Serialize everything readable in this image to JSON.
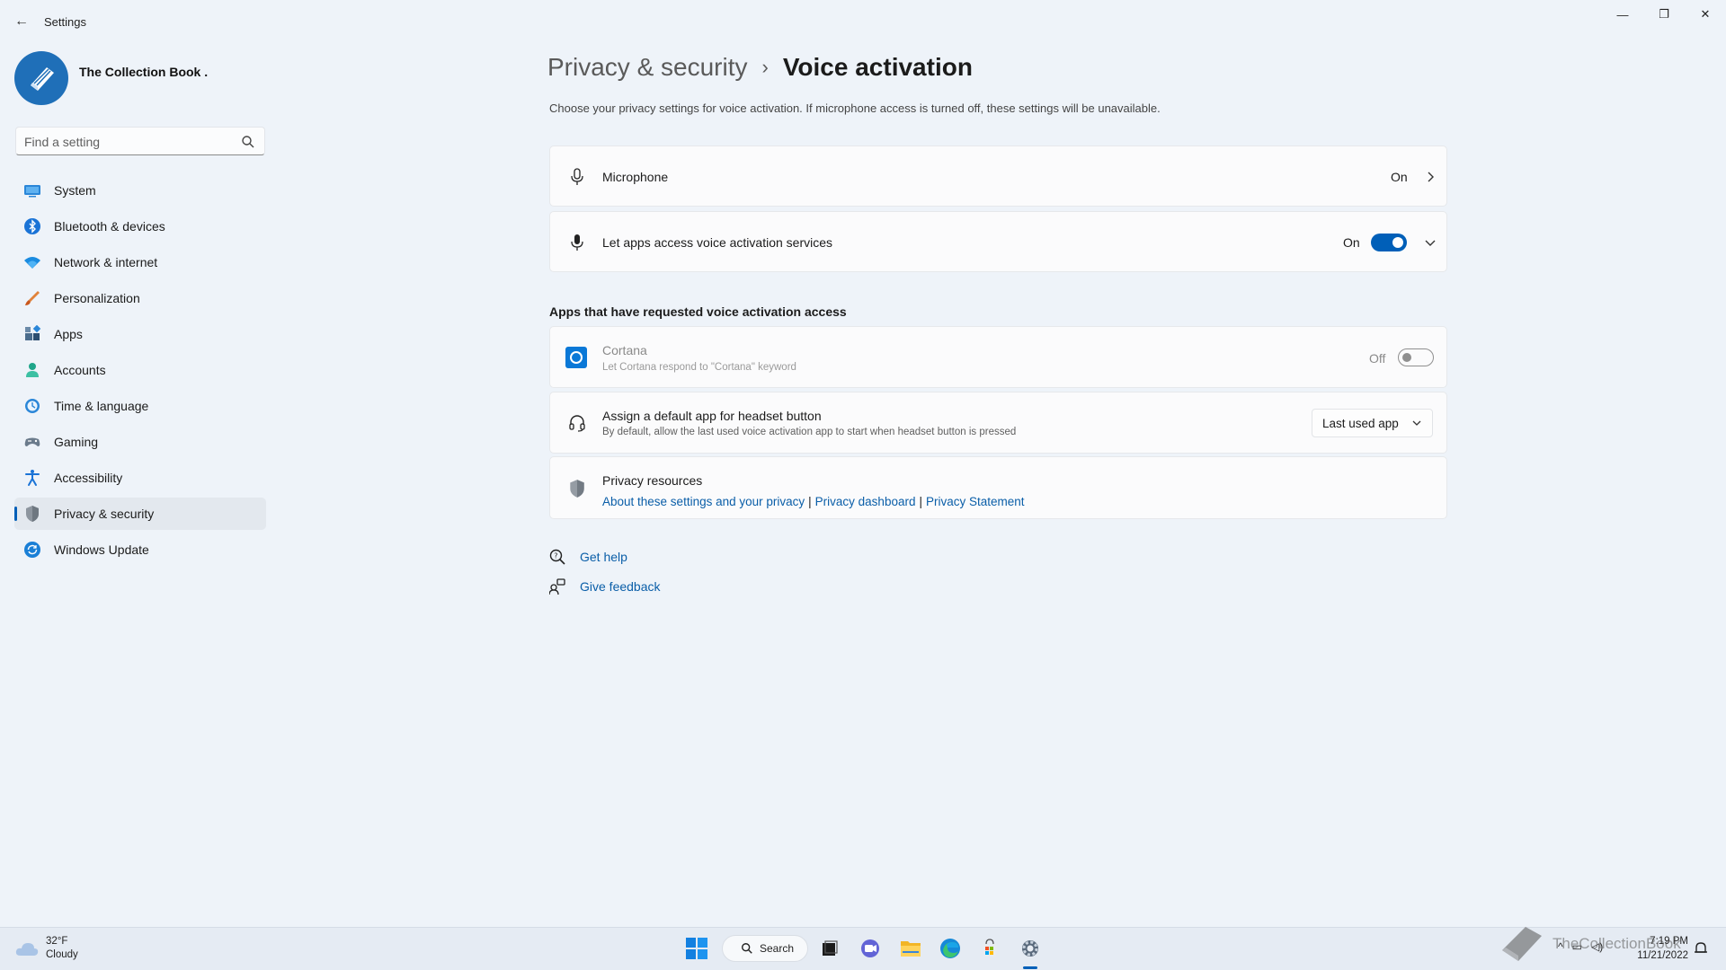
{
  "window": {
    "title": "Settings",
    "back": "←",
    "minimize": "—",
    "maximize": "❐",
    "close": "✕"
  },
  "profile": {
    "name": "The Collection Book ."
  },
  "search": {
    "placeholder": "Find a setting"
  },
  "nav": {
    "items": [
      {
        "label": "System",
        "icon": "system-icon"
      },
      {
        "label": "Bluetooth & devices",
        "icon": "bluetooth-icon"
      },
      {
        "label": "Network & internet",
        "icon": "wifi-icon"
      },
      {
        "label": "Personalization",
        "icon": "brush-icon"
      },
      {
        "label": "Apps",
        "icon": "apps-icon"
      },
      {
        "label": "Accounts",
        "icon": "account-icon"
      },
      {
        "label": "Time & language",
        "icon": "time-language-icon"
      },
      {
        "label": "Gaming",
        "icon": "gamepad-icon"
      },
      {
        "label": "Accessibility",
        "icon": "accessibility-icon"
      },
      {
        "label": "Privacy & security",
        "icon": "shield-icon",
        "active": true
      },
      {
        "label": "Windows Update",
        "icon": "update-icon"
      }
    ]
  },
  "header": {
    "parent": "Privacy & security",
    "separator": "›",
    "current": "Voice activation",
    "description": "Choose your privacy settings for voice activation. If microphone access is turned off, these settings will be unavailable."
  },
  "microphone": {
    "title": "Microphone",
    "state": "On"
  },
  "voice_access": {
    "title": "Let apps access voice activation services",
    "state": "On",
    "enabled": true
  },
  "apps_section": {
    "heading": "Apps that have requested voice activation access"
  },
  "cortana": {
    "title": "Cortana",
    "subtitle": "Let Cortana respond to \"Cortana\" keyword",
    "state": "Off",
    "enabled": false
  },
  "headset": {
    "title": "Assign a default app for headset button",
    "subtitle": "By default, allow the last used voice activation app to start when headset button is pressed",
    "selected": "Last used app"
  },
  "privacy_resources": {
    "title": "Privacy resources",
    "link1": "About these settings and your privacy",
    "link2": "Privacy dashboard",
    "link3": "Privacy Statement",
    "sep": "|"
  },
  "help": {
    "get_help": "Get help",
    "give_feedback": "Give feedback"
  },
  "taskbar": {
    "weather_temp": "32°F",
    "weather_desc": "Cloudy",
    "search_label": "Search",
    "time": "7:19 PM",
    "date": "11/21/2022",
    "tray_chevron": "^"
  },
  "watermark": {
    "text": "TheCollectionBook"
  },
  "colors": {
    "accent": "#005fb8",
    "link": "#0a5ea8",
    "background": "#eef3f9"
  }
}
